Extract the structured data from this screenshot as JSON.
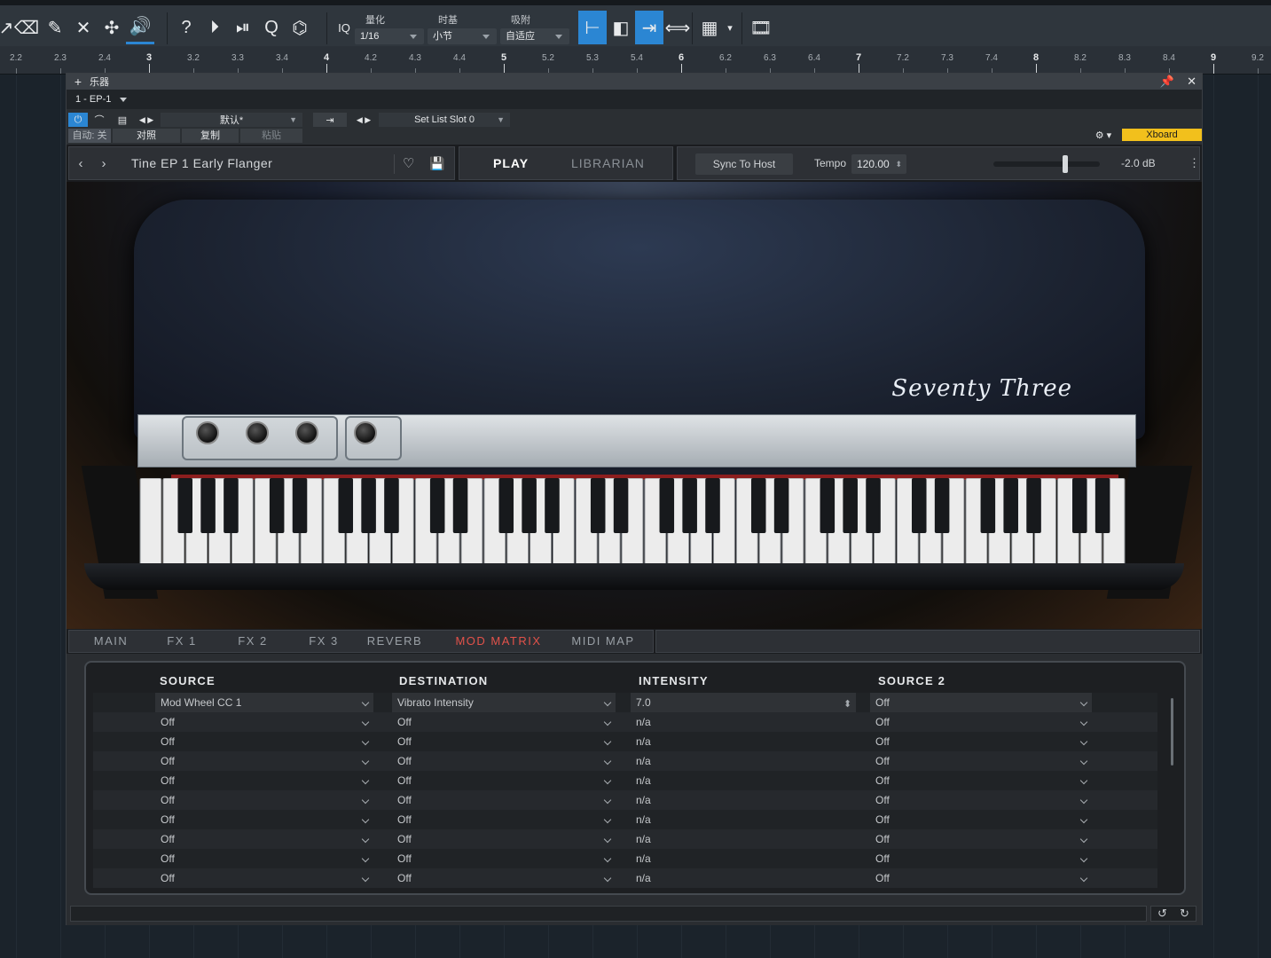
{
  "toolbar": {
    "iq_label": "IQ",
    "quantize": {
      "label": "量化",
      "value": "1/16"
    },
    "timebase": {
      "label": "时基",
      "value": "小节"
    },
    "snap": {
      "label": "吸附",
      "value": "自适应"
    }
  },
  "ruler": {
    "ticks": [
      "2.2",
      "2.3",
      "2.4",
      "3",
      "3.2",
      "3.3",
      "3.4",
      "4",
      "4.2",
      "4.3",
      "4.4",
      "5",
      "5.2",
      "5.3",
      "5.4",
      "6",
      "6.2",
      "6.3",
      "6.4",
      "7",
      "7.2",
      "7.3",
      "7.4",
      "8",
      "8.2",
      "8.3",
      "8.4",
      "9",
      "9.2"
    ]
  },
  "window": {
    "title": "乐器",
    "instrument": "1 - EP-1",
    "preset_default": "默认*",
    "setlist": "Set List Slot 0",
    "auto_label": "自动: 关",
    "compare_label": "对照",
    "copy_label": "复制",
    "paste_label": "粘贴",
    "xboard_label": "Xboard"
  },
  "header": {
    "preset_name": "Tine EP 1 Early Flanger",
    "play_tab": "PLAY",
    "librarian_tab": "LIBRARIAN",
    "sync_label": "Sync To Host",
    "tempo_label": "Tempo",
    "tempo_value": "120.00",
    "volume_value": "-2.0 dB",
    "volume_level": 0.68
  },
  "tabs": [
    {
      "label": "MAIN",
      "active": false
    },
    {
      "label": "FX 1",
      "active": false
    },
    {
      "label": "FX 2",
      "active": false
    },
    {
      "label": "FX 3",
      "active": false
    },
    {
      "label": "REVERB",
      "active": false
    },
    {
      "label": "MOD MATRIX",
      "active": true
    },
    {
      "label": "MIDI MAP",
      "active": false
    }
  ],
  "matrix": {
    "headers": {
      "source": "SOURCE",
      "destination": "DESTINATION",
      "intensity": "INTENSITY",
      "source2": "SOURCE 2"
    },
    "rows": [
      {
        "source": "Mod Wheel CC 1",
        "destination": "Vibrato Intensity",
        "intensity": "7.0",
        "source2": "Off"
      },
      {
        "source": "Off",
        "destination": "Off",
        "intensity": "n/a",
        "source2": "Off"
      },
      {
        "source": "Off",
        "destination": "Off",
        "intensity": "n/a",
        "source2": "Off"
      },
      {
        "source": "Off",
        "destination": "Off",
        "intensity": "n/a",
        "source2": "Off"
      },
      {
        "source": "Off",
        "destination": "Off",
        "intensity": "n/a",
        "source2": "Off"
      },
      {
        "source": "Off",
        "destination": "Off",
        "intensity": "n/a",
        "source2": "Off"
      },
      {
        "source": "Off",
        "destination": "Off",
        "intensity": "n/a",
        "source2": "Off"
      },
      {
        "source": "Off",
        "destination": "Off",
        "intensity": "n/a",
        "source2": "Off"
      },
      {
        "source": "Off",
        "destination": "Off",
        "intensity": "n/a",
        "source2": "Off"
      },
      {
        "source": "Off",
        "destination": "Off",
        "intensity": "n/a",
        "source2": "Off"
      }
    ]
  },
  "brand_text": "Seventy Three",
  "colors": {
    "accent_blue": "#2b86d3",
    "active_tab": "#e2524a",
    "xboard": "#f2c01c"
  }
}
